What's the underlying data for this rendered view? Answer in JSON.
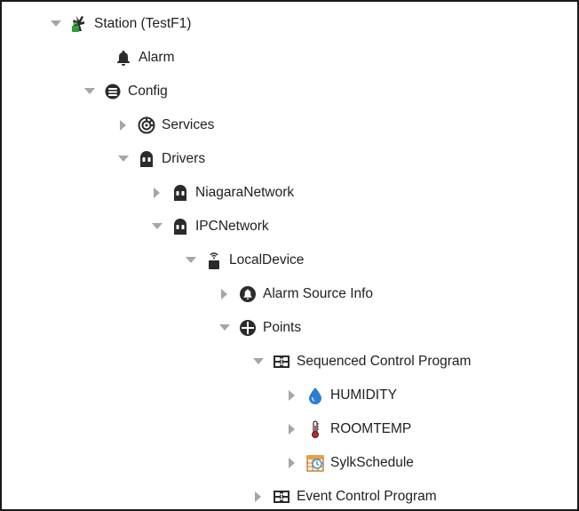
{
  "colors": {
    "text": "#1f1f1f",
    "arrow": "#a6a6a6",
    "icon_dark": "#2b2b2b",
    "station_green": "#2e9c3a",
    "humidity_blue": "#2a7fd4",
    "thermo_red": "#c62828",
    "schedule_orange": "#e6a23c"
  },
  "tree": [
    {
      "label": "Station (TestF1)",
      "expander": "expanded",
      "icon": "station-icon"
    },
    {
      "label": "Alarm",
      "expander": "none",
      "icon": "bell-icon"
    },
    {
      "label": "Config",
      "expander": "expanded",
      "icon": "database-icon"
    },
    {
      "label": "Services",
      "expander": "collapsed",
      "icon": "services-icon"
    },
    {
      "label": "Drivers",
      "expander": "expanded",
      "icon": "driver-icon"
    },
    {
      "label": "NiagaraNetwork",
      "expander": "collapsed",
      "icon": "network-icon"
    },
    {
      "label": "IPCNetwork",
      "expander": "expanded",
      "icon": "network-icon"
    },
    {
      "label": "LocalDevice",
      "expander": "expanded",
      "icon": "device-icon"
    },
    {
      "label": "Alarm Source Info",
      "expander": "collapsed",
      "icon": "alarm-source-icon"
    },
    {
      "label": "Points",
      "expander": "expanded",
      "icon": "points-icon"
    },
    {
      "label": "Sequenced Control Program",
      "expander": "expanded",
      "icon": "program-icon"
    },
    {
      "label": "HUMIDITY",
      "expander": "collapsed",
      "icon": "humidity-drop-icon"
    },
    {
      "label": "ROOMTEMP",
      "expander": "collapsed",
      "icon": "thermometer-icon"
    },
    {
      "label": "SylkSchedule",
      "expander": "collapsed",
      "icon": "schedule-icon"
    },
    {
      "label": "Event Control Program",
      "expander": "collapsed",
      "icon": "program-icon"
    }
  ]
}
